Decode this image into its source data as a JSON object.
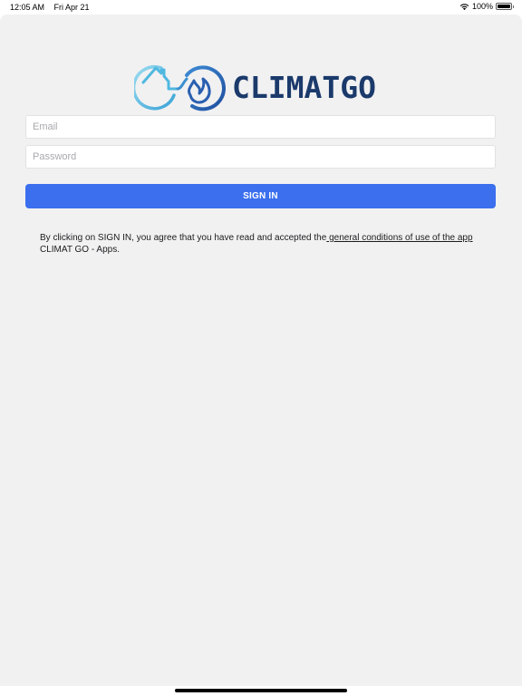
{
  "status_bar": {
    "time": "12:05 AM",
    "date": "Fri Apr 21",
    "battery_percent": "100%",
    "battery_level": 1.0
  },
  "logo": {
    "text": "CLIMATGO"
  },
  "form": {
    "email_placeholder": "Email",
    "email_value": "",
    "password_placeholder": "Password",
    "password_value": "",
    "signin_label": "SIGN IN"
  },
  "terms": {
    "prefix": "By clicking on SIGN IN, you agree that you have read and accepted the",
    "link_text": " general conditions of use of the app",
    "suffix": "CLIMAT GO - Apps."
  },
  "colors": {
    "primary": "#3b6fee",
    "logo_text": "#1b3a6b",
    "logo_icon_light": "#4fb8e0",
    "logo_icon_dark": "#2a5fb0",
    "background": "#f1f1f2"
  }
}
